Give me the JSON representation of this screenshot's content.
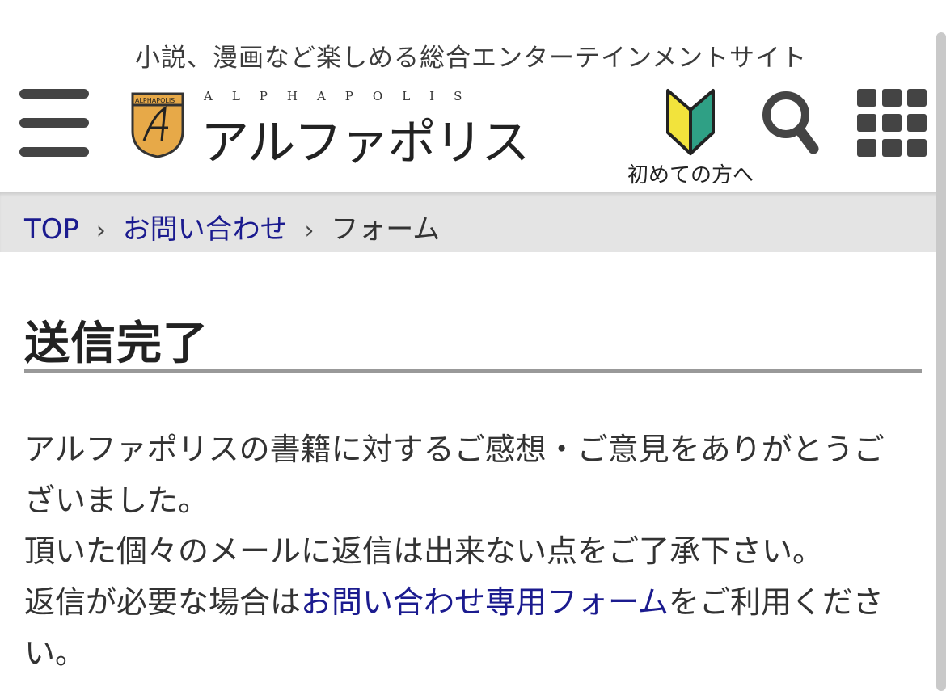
{
  "header": {
    "tagline": "小説、漫画など楽しめる総合エンターテインメントサイト",
    "logo_emblem_text": "ALPHAPOLIS",
    "logo_latin": "ALPHAPOLIS",
    "logo_kana": "アルファポリス",
    "beginner_label": "初めての方へ",
    "icons": {
      "menu": "hamburger-menu-icon",
      "beginner": "beginner-mark-icon",
      "search": "search-icon",
      "grid": "grid-menu-icon"
    }
  },
  "breadcrumb": {
    "items": [
      {
        "label": "TOP",
        "link": true
      },
      {
        "label": "お問い合わせ",
        "link": true
      },
      {
        "label": "フォーム",
        "link": false
      }
    ],
    "separator": "›"
  },
  "main": {
    "title": "送信完了",
    "paragraph1": "アルファポリスの書籍に対するご感想・ご意見をありがとうございました。",
    "paragraph2": "頂いた個々のメールに返信は出来ない点をご了承下さい。",
    "paragraph3_before": "返信が必要な場合は",
    "paragraph3_link": "お問い合わせ専用フォーム",
    "paragraph3_after": "をご利用ください。"
  },
  "colors": {
    "link": "#1b1b8f",
    "text": "#333333",
    "breadcrumb_bg": "#e4e4e4",
    "icon_dark": "#444444",
    "emblem_gold": "#e7a948",
    "beginner_yellow": "#f2e33c",
    "beginner_green": "#2fa085"
  }
}
